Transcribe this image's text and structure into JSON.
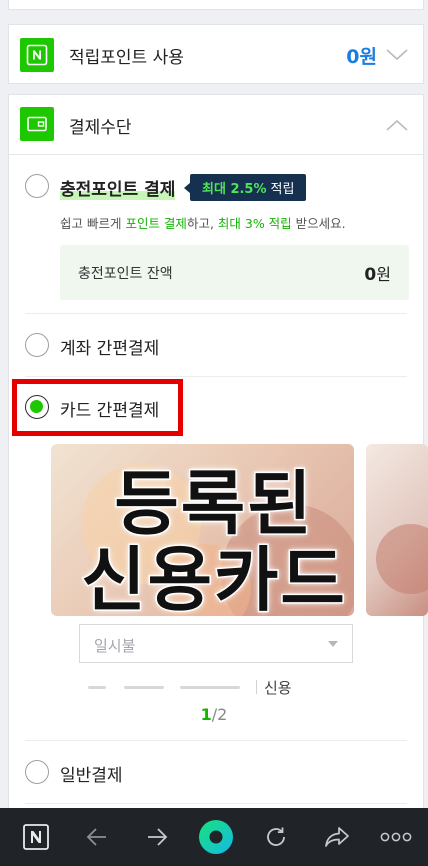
{
  "points_section": {
    "title": "적립포인트 사용",
    "value": "0원"
  },
  "payment_section": {
    "title": "결제수단",
    "options": {
      "charge_point": {
        "label": "충전포인트 결제",
        "badge_highlight": "최대 2.5%",
        "badge_suffix": "적립",
        "desc_prefix": "쉽고 빠르게 ",
        "desc_highlight1": "포인트 결제",
        "desc_middle": "하고, ",
        "desc_highlight2": "최대 3% 적립",
        "desc_suffix": " 받으세요.",
        "balance_label": "충전포인트 잔액",
        "balance_value": "0",
        "balance_unit": "원"
      },
      "account": {
        "label": "계좌 간편결제"
      },
      "card": {
        "label": "카드 간편결제",
        "selected": true
      },
      "general": {
        "label": "일반결제"
      }
    },
    "card_overlay": {
      "line1": "등록된",
      "line2": "신용카드"
    },
    "installment": {
      "value": "일시불"
    },
    "card_type": "신용",
    "pager": {
      "current": "1",
      "total": "/2"
    }
  },
  "bottom_nav": {
    "icons": [
      "naver-home-icon",
      "back-arrow-icon",
      "forward-arrow-icon",
      "naver-green-dot-icon",
      "refresh-icon",
      "share-icon",
      "more-icon"
    ]
  },
  "colors": {
    "accent_green": "#1ec800",
    "link_blue": "#1a7de0",
    "badge_navy": "#16304f",
    "highlight_red": "#e50000"
  }
}
